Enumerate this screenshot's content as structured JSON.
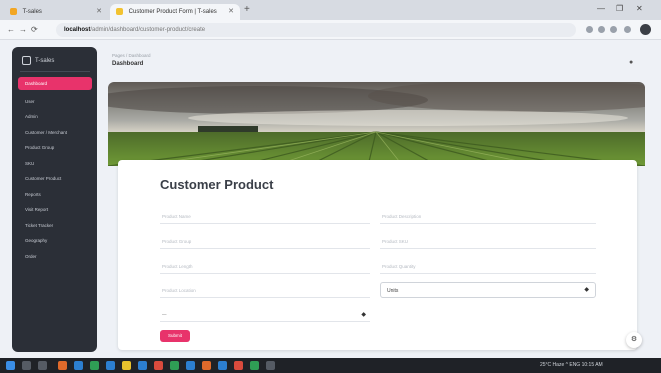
{
  "browser": {
    "tabs": [
      {
        "label": "T-sales",
        "icon": "app-tab-icon"
      },
      {
        "label": "Customer Product Form | T-sales",
        "icon": "page-tab-icon"
      }
    ],
    "new_tab": "+",
    "url_host": "localhost",
    "url_path": "/admin/dashboard/customer-product/create",
    "window_controls": [
      "—",
      "❐",
      "✕"
    ]
  },
  "sidebar": {
    "brand": "T-sales",
    "items": [
      {
        "label": "Dashboard",
        "active": true
      },
      {
        "label": "User"
      },
      {
        "label": "Admin"
      },
      {
        "label": "Customer / Merchant"
      },
      {
        "label": "Product Group"
      },
      {
        "label": "SKU"
      },
      {
        "label": "Customer Product"
      },
      {
        "label": "Reports"
      },
      {
        "label": "Visit Report"
      },
      {
        "label": "Ticket Tracker"
      },
      {
        "label": "Geography"
      },
      {
        "label": "Order"
      }
    ]
  },
  "header": {
    "breadcrumb": "Pages / Dashboard",
    "title": "Dashboard"
  },
  "form": {
    "title": "Customer Product",
    "fields": [
      {
        "placeholder": "Product Name"
      },
      {
        "placeholder": "Product Description"
      },
      {
        "placeholder": "Product Group"
      },
      {
        "placeholder": "Product SKU"
      },
      {
        "placeholder": "Product Length"
      },
      {
        "placeholder": "Product Quantity"
      },
      {
        "placeholder": "Product Location"
      }
    ],
    "select_unit": "Units",
    "select_second": "—",
    "submit_label": "Submit"
  },
  "taskbar": {
    "tray_text": "25°C Haze  ^  ENG  10:15 AM"
  },
  "colors": {
    "accent": "#e8336b",
    "sidebar_bg": "#2b2f37"
  }
}
